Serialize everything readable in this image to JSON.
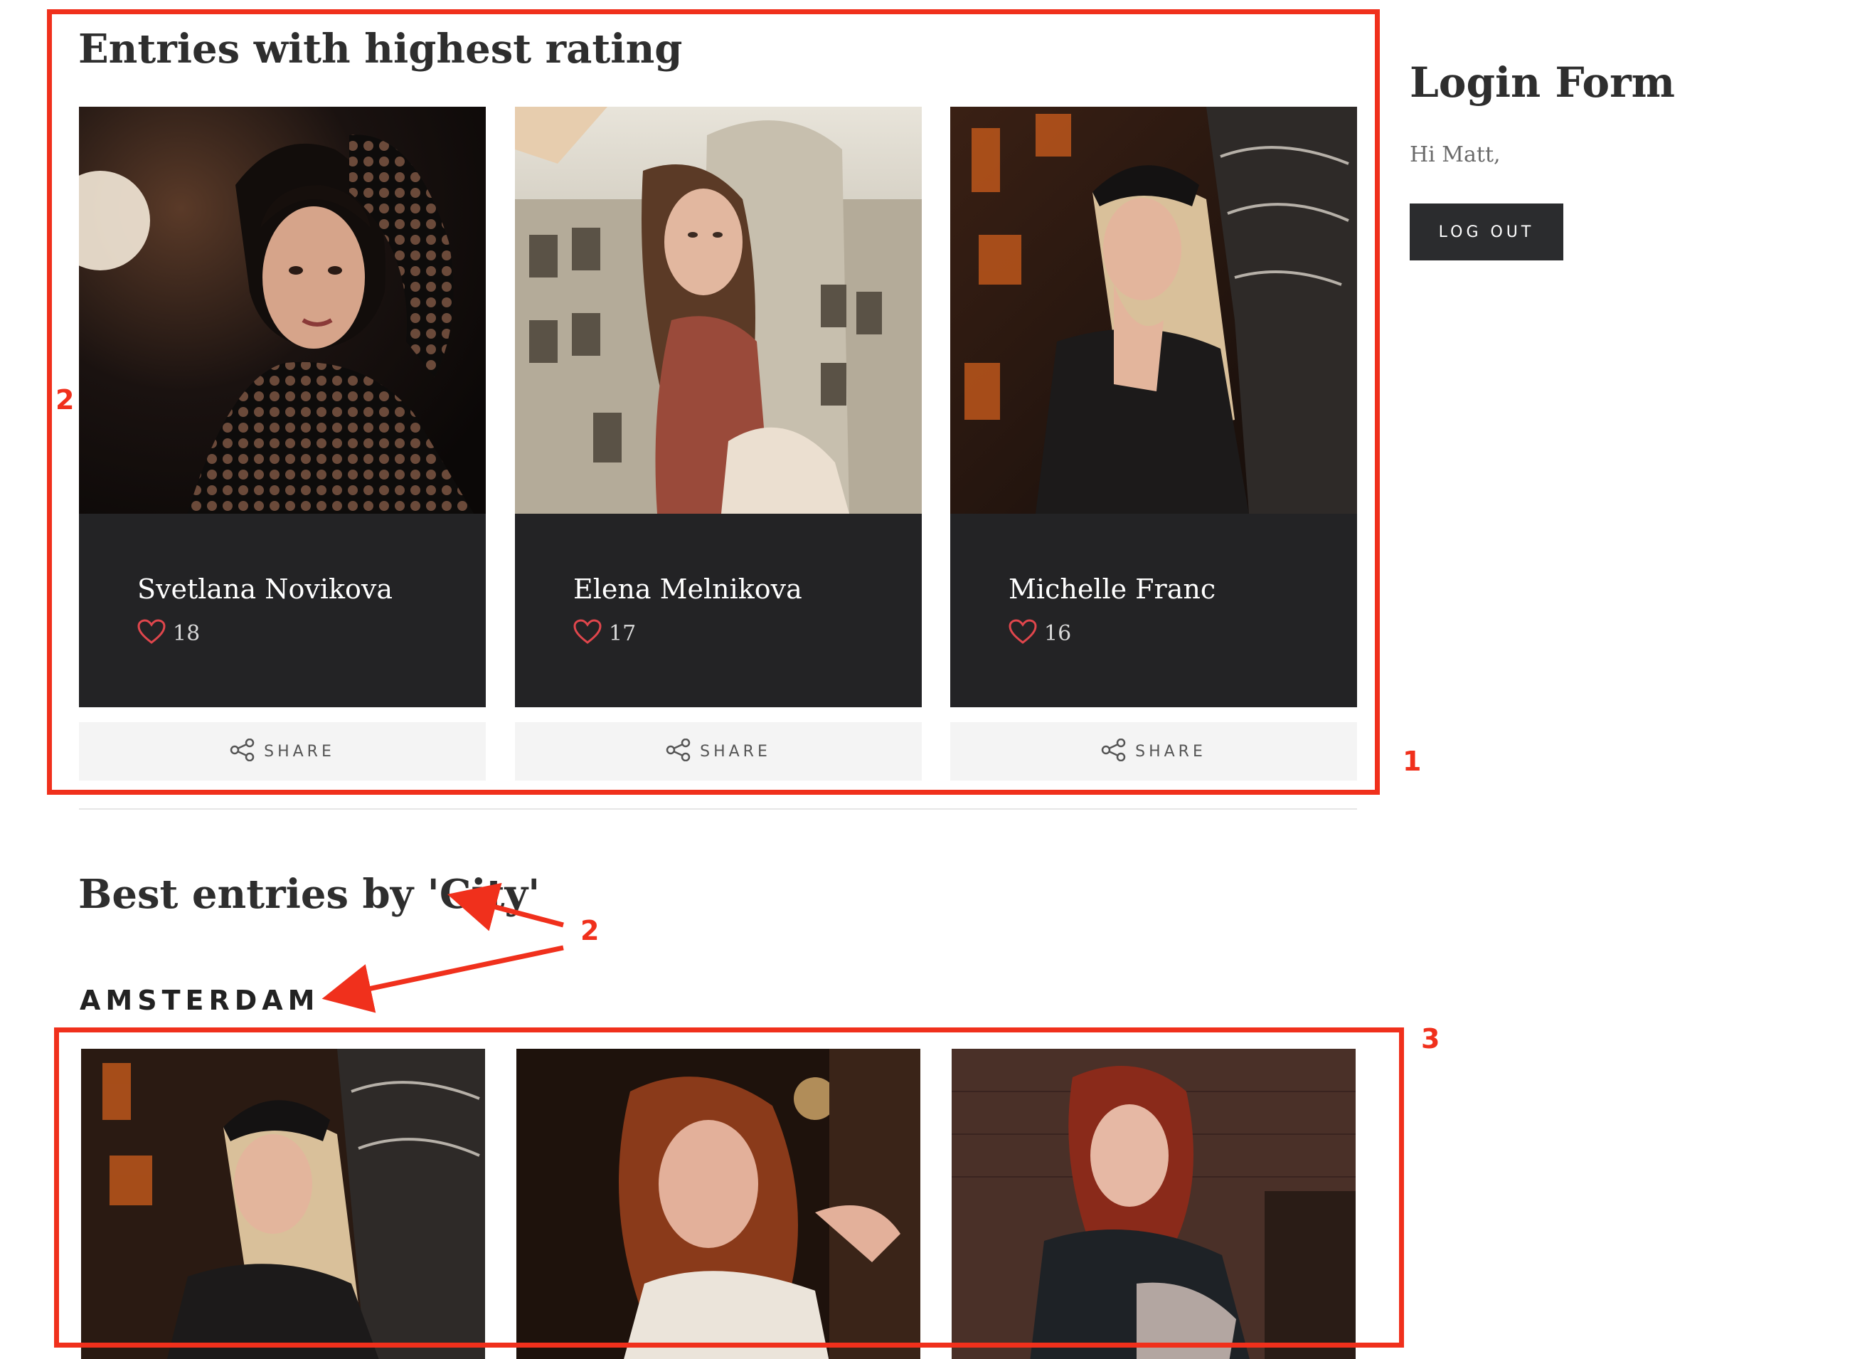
{
  "top_section": {
    "title": "Entries with highest rating",
    "entries": [
      {
        "name": "Svetlana Novikova",
        "likes": "18",
        "share_label": "SHARE"
      },
      {
        "name": "Elena Melnikova",
        "likes": "17",
        "share_label": "SHARE"
      },
      {
        "name": "Michelle Franc",
        "likes": "16",
        "share_label": "SHARE"
      }
    ]
  },
  "city_section": {
    "title": "Best entries by 'City'",
    "city": "AMSTERDAM"
  },
  "sidebar": {
    "login_title": "Login Form",
    "greeting": "Hi Matt,",
    "logout_label": "LOG OUT"
  },
  "annotations": {
    "box1_number": "1",
    "label2_left": "2",
    "label2_arrows": "2",
    "box3_number": "3"
  },
  "colors": {
    "annotation": "#f0301c",
    "card_dark": "#232325",
    "heart": "#e0464c",
    "button_dark": "#2b2c2e"
  },
  "icons": {
    "heart": "heart-icon",
    "share": "share-icon"
  }
}
